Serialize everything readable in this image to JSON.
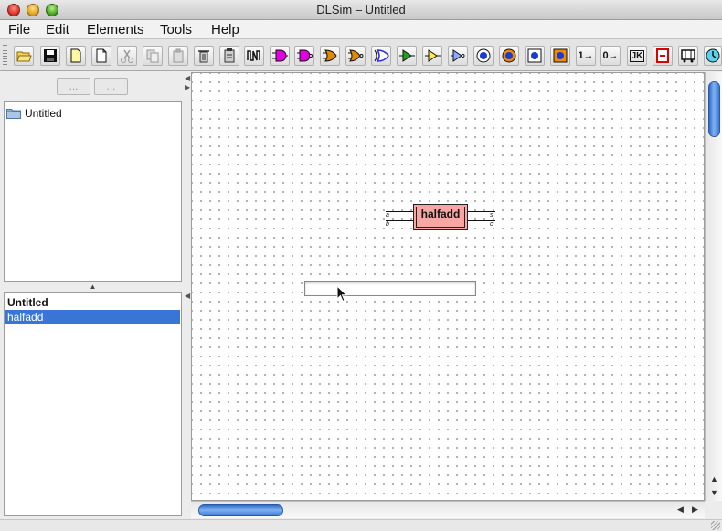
{
  "window": {
    "title": "DLSim – Untitled"
  },
  "menubar": {
    "items": [
      "File",
      "Edit",
      "Elements",
      "Tools",
      "Help"
    ]
  },
  "toolbar": {
    "buttons": [
      {
        "name": "open-icon"
      },
      {
        "name": "save-icon"
      },
      {
        "name": "new-page-icon"
      },
      {
        "name": "blank-page-icon"
      },
      {
        "name": "cut-icon"
      },
      {
        "name": "copy-icon"
      },
      {
        "name": "paste-icon"
      },
      {
        "name": "delete-icon"
      },
      {
        "name": "clipboard-icon"
      },
      {
        "name": "waveform-icon"
      },
      {
        "name": "and-gate-icon",
        "color": "#e000e0"
      },
      {
        "name": "nand-gate-icon",
        "color": "#e000e0"
      },
      {
        "name": "or-gate-icon",
        "color": "#e08a00"
      },
      {
        "name": "nor-gate-icon",
        "color": "#e08a00"
      },
      {
        "name": "xor-gate-icon",
        "color": "#3030d0"
      },
      {
        "name": "buffer-icon",
        "color": "#20a020"
      },
      {
        "name": "buffer-yellow-icon",
        "color": "#c8b000"
      },
      {
        "name": "not-gate-icon",
        "color": "#3030d0"
      },
      {
        "name": "probe-blue-icon",
        "color": "#1a3ad8"
      },
      {
        "name": "probe-orange-icon",
        "color": "#f08a00"
      },
      {
        "name": "probe-light-icon",
        "color": "#1a3ad8"
      },
      {
        "name": "probe-orange2-icon",
        "color": "#f08a00"
      }
    ],
    "text_buttons": [
      "1→",
      "0→",
      "JK"
    ],
    "extra_icons": [
      "register-icon",
      "bus-icon",
      "clock-icon"
    ]
  },
  "leftpanel": {
    "nav_back": "...",
    "nav_forward": "...",
    "tree_root": "Untitled",
    "list_header": "Untitled",
    "list_selected": "halfadd"
  },
  "canvas": {
    "component_label": "halfadd",
    "pins_in": [
      "a",
      "b"
    ],
    "pins_out": [
      "s",
      "c"
    ],
    "component_color": "#f7a7a3",
    "name_input_value": ""
  }
}
